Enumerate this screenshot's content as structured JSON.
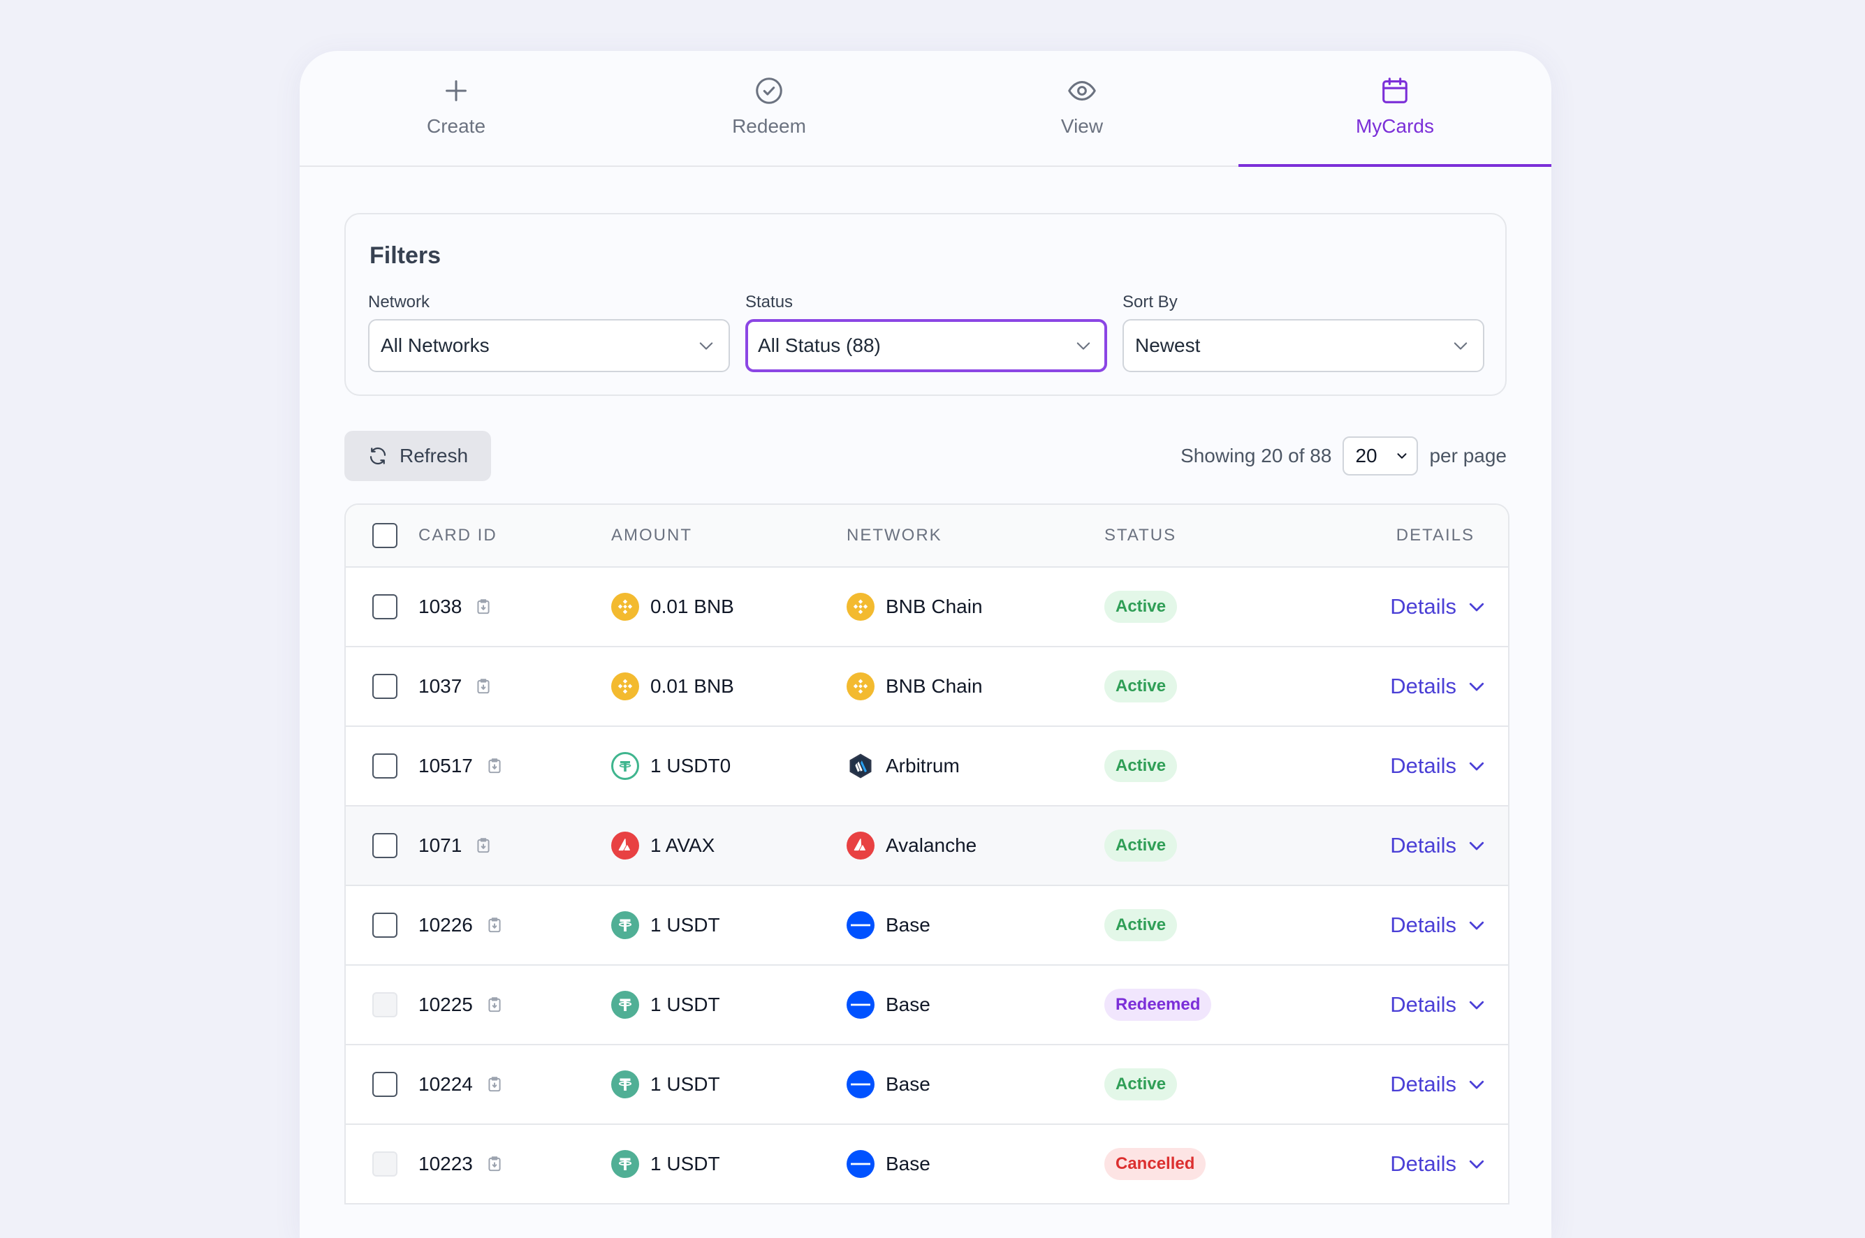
{
  "tabs": [
    {
      "label": "Create",
      "icon": "plus-icon"
    },
    {
      "label": "Redeem",
      "icon": "check-circle-icon"
    },
    {
      "label": "View",
      "icon": "eye-icon"
    },
    {
      "label": "MyCards",
      "icon": "calendar-icon",
      "active": true
    }
  ],
  "filters": {
    "title": "Filters",
    "network": {
      "label": "Network",
      "value": "All Networks"
    },
    "status": {
      "label": "Status",
      "value": "All Status (88)"
    },
    "sort": {
      "label": "Sort By",
      "value": "Newest"
    }
  },
  "toolbar": {
    "refresh_label": "Refresh",
    "showing_text": "Showing 20 of 88",
    "per_page_value": "20",
    "per_page_label": "per page"
  },
  "table": {
    "headers": {
      "card_id": "CARD ID",
      "amount": "AMOUNT",
      "network": "NETWORK",
      "status": "STATUS",
      "details": "DETAILS"
    },
    "details_label": "Details",
    "rows": [
      {
        "id": "1038",
        "amount": "0.01 BNB",
        "token": "bnb",
        "network": "BNB Chain",
        "network_icon": "bnb",
        "status": "Active"
      },
      {
        "id": "1037",
        "amount": "0.01 BNB",
        "token": "bnb",
        "network": "BNB Chain",
        "network_icon": "bnb",
        "status": "Active"
      },
      {
        "id": "10517",
        "amount": "1 USDT0",
        "token": "usdt0",
        "network": "Arbitrum",
        "network_icon": "arbitrum",
        "status": "Active"
      },
      {
        "id": "1071",
        "amount": "1 AVAX",
        "token": "avax",
        "network": "Avalanche",
        "network_icon": "avax",
        "status": "Active"
      },
      {
        "id": "10226",
        "amount": "1 USDT",
        "token": "usdt",
        "network": "Base",
        "network_icon": "base",
        "status": "Active"
      },
      {
        "id": "10225",
        "amount": "1 USDT",
        "token": "usdt",
        "network": "Base",
        "network_icon": "base",
        "status": "Redeemed"
      },
      {
        "id": "10224",
        "amount": "1 USDT",
        "token": "usdt",
        "network": "Base",
        "network_icon": "base",
        "status": "Active"
      },
      {
        "id": "10223",
        "amount": "1 USDT",
        "token": "usdt",
        "network": "Base",
        "network_icon": "base",
        "status": "Cancelled"
      }
    ]
  },
  "colors": {
    "accent": "#7b2fd8",
    "link": "#4a3fd6",
    "active_badge": "#2f9e56",
    "redeemed_badge": "#7b2fd8",
    "cancelled_badge": "#dc2f2f"
  }
}
